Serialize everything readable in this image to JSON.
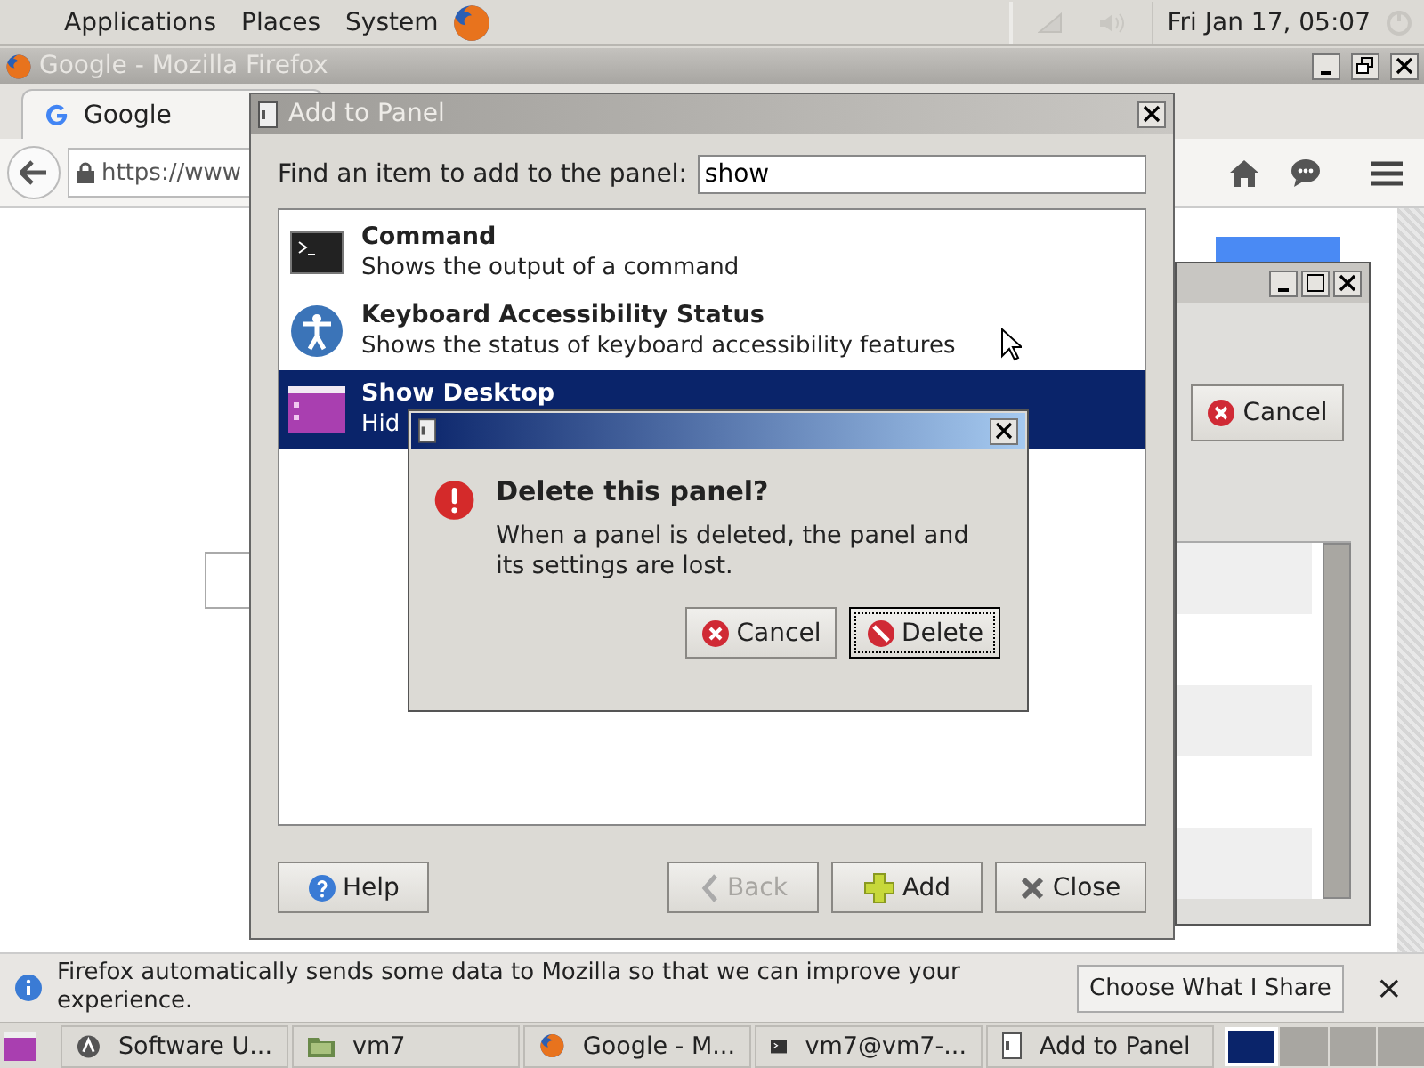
{
  "top_panel": {
    "menus": [
      "Applications",
      "Places",
      "System"
    ],
    "clock": "Fri Jan 17, 05:07"
  },
  "browser": {
    "title": "Google - Mozilla Firefox",
    "tabs": [
      {
        "label": "Google",
        "selected": true
      }
    ],
    "url": "https://www"
  },
  "background_window": {
    "button": "Cancel"
  },
  "add_to_panel": {
    "title": "Add to Panel",
    "search_label": "Find an item to add to the panel:",
    "search_value": "show",
    "items": [
      {
        "name": "Command",
        "description": "Shows the output of a command",
        "kind": "terminal",
        "selected": false
      },
      {
        "name": "Keyboard Accessibility Status",
        "description": "Shows the status of keyboard accessibility features",
        "kind": "accessibility",
        "selected": false
      },
      {
        "name": "Show Desktop",
        "description": "Hid",
        "kind": "desktop",
        "selected": true
      }
    ],
    "buttons": [
      {
        "label": "Help",
        "kind": "help",
        "disabled": false
      },
      {
        "label": "Back",
        "kind": "back",
        "disabled": true
      },
      {
        "label": "Add",
        "kind": "add",
        "disabled": false
      },
      {
        "label": "Close",
        "kind": "close",
        "disabled": false
      }
    ]
  },
  "confirm": {
    "heading": "Delete this panel?",
    "message": "When a panel is deleted, the panel and its settings are lost.",
    "buttons": [
      {
        "label": "Cancel",
        "kind": "cancel",
        "focused": false
      },
      {
        "label": "Delete",
        "kind": "delete",
        "focused": true
      }
    ]
  },
  "notification": {
    "message": "Firefox automatically sends some data to Mozilla so that we can improve your experience.",
    "button": "Choose What I Share",
    "close": "×"
  },
  "taskbar": {
    "tasks": [
      {
        "label": "Software U...",
        "kind": "software"
      },
      {
        "label": "vm7",
        "kind": "folder"
      },
      {
        "label": "Google - M...",
        "kind": "firefox"
      },
      {
        "label": "vm7@vm7-...",
        "kind": "terminal"
      },
      {
        "label": "Add to Panel",
        "kind": "window"
      }
    ]
  }
}
